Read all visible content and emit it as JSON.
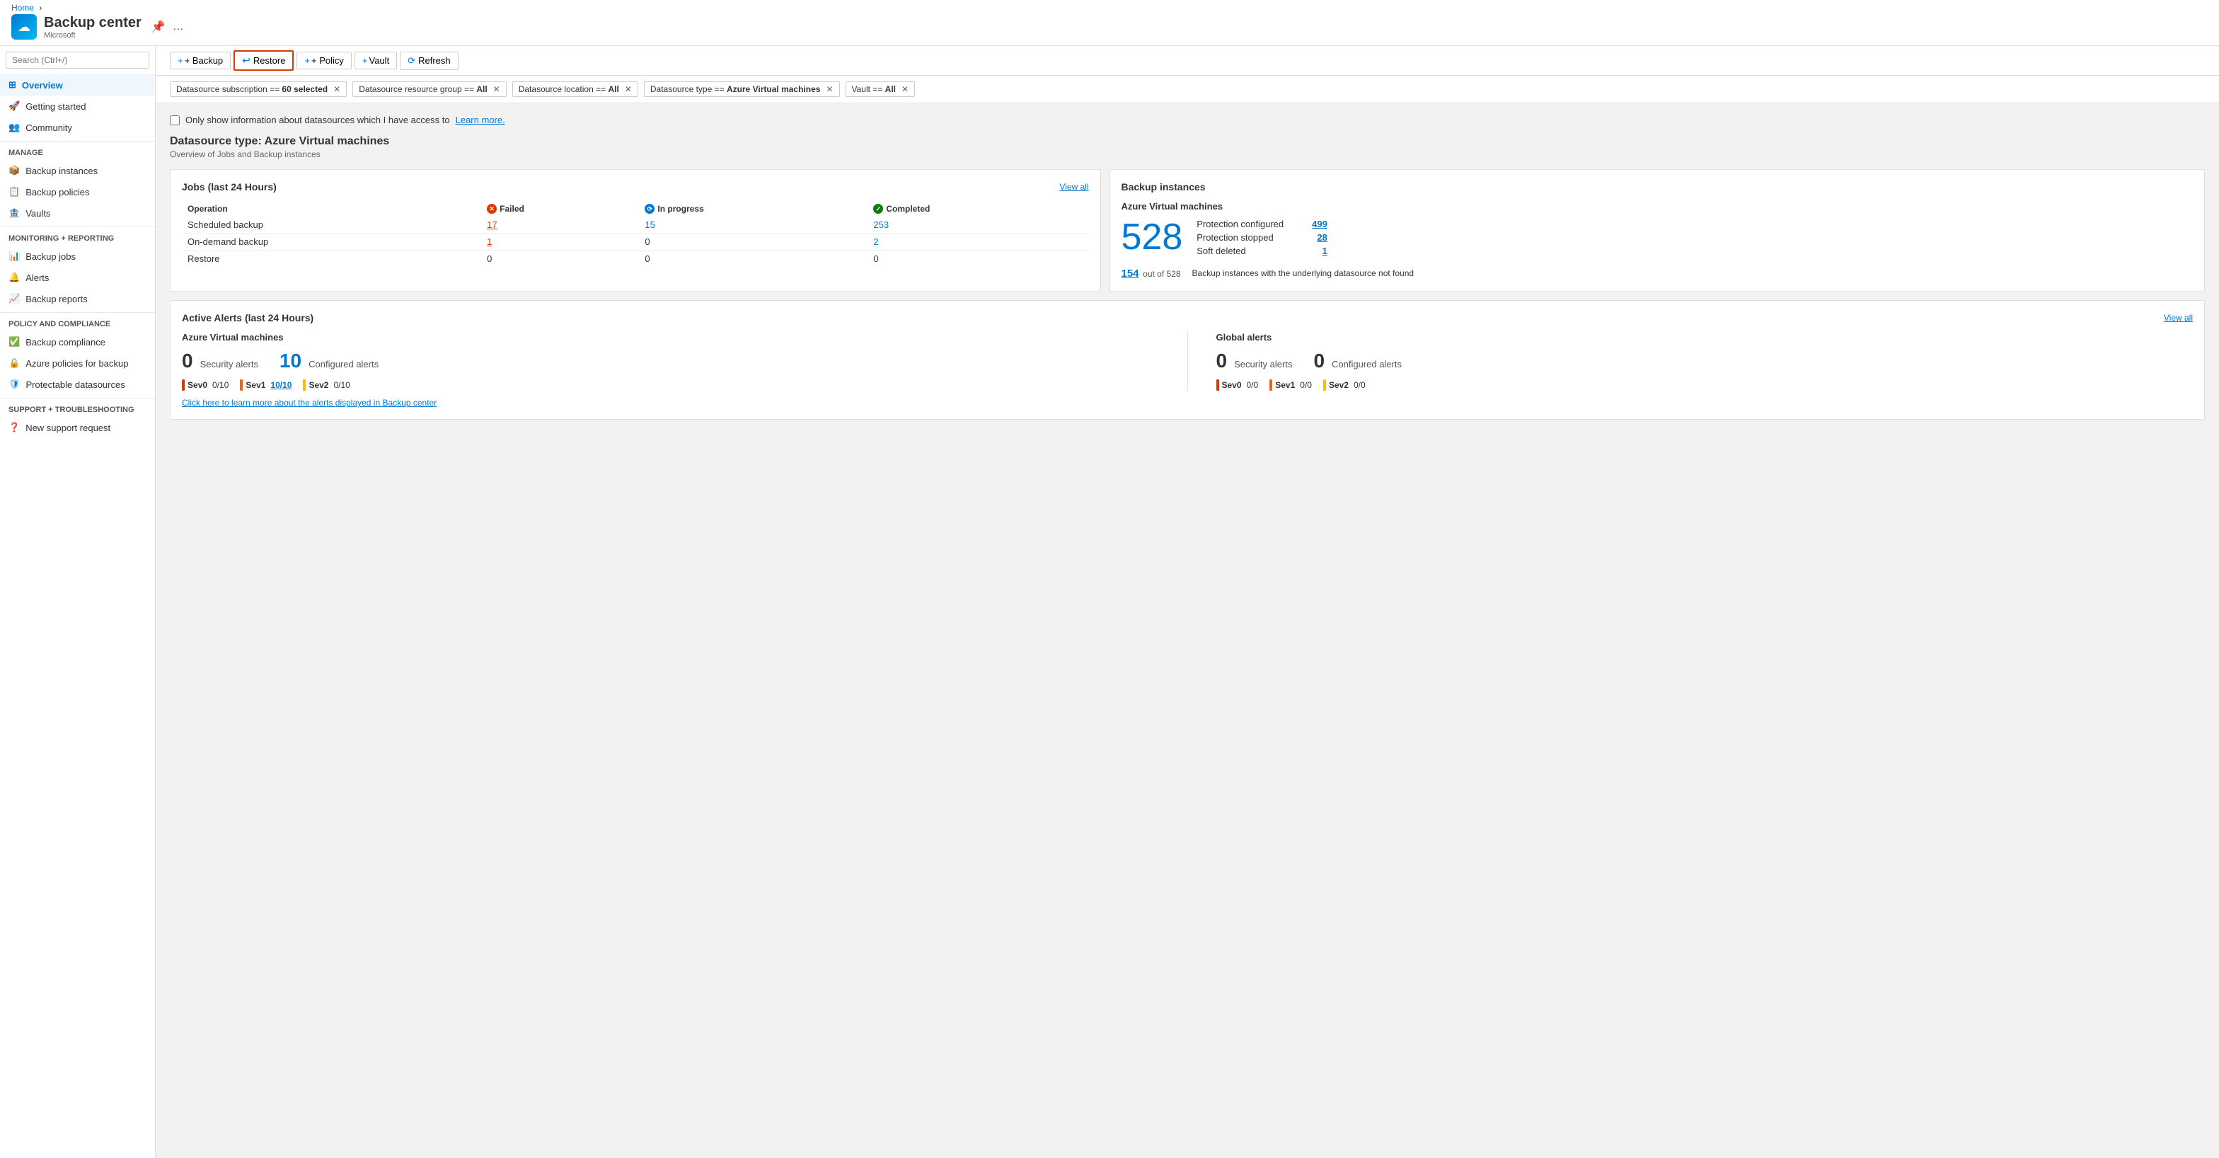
{
  "breadcrumb": {
    "home": "Home"
  },
  "app": {
    "title": "Backup center",
    "subtitle": "Microsoft",
    "icon": "☁"
  },
  "sidebar": {
    "search_placeholder": "Search (Ctrl+/)",
    "collapse_icon": "«",
    "nav_items": [
      {
        "id": "overview",
        "label": "Overview",
        "active": true,
        "icon": "⊞"
      },
      {
        "id": "getting-started",
        "label": "Getting started",
        "icon": "🚀"
      },
      {
        "id": "community",
        "label": "Community",
        "icon": "👥"
      }
    ],
    "sections": [
      {
        "label": "Manage",
        "items": [
          {
            "id": "backup-instances",
            "label": "Backup instances",
            "icon": "📦"
          },
          {
            "id": "backup-policies",
            "label": "Backup policies",
            "icon": "📋"
          },
          {
            "id": "vaults",
            "label": "Vaults",
            "icon": "🏦"
          }
        ]
      },
      {
        "label": "Monitoring + reporting",
        "items": [
          {
            "id": "backup-jobs",
            "label": "Backup jobs",
            "icon": "📊"
          },
          {
            "id": "alerts",
            "label": "Alerts",
            "icon": "🔔"
          },
          {
            "id": "backup-reports",
            "label": "Backup reports",
            "icon": "📈"
          }
        ]
      },
      {
        "label": "Policy and compliance",
        "items": [
          {
            "id": "backup-compliance",
            "label": "Backup compliance",
            "icon": "✅"
          },
          {
            "id": "azure-policies",
            "label": "Azure policies for backup",
            "icon": "🔒"
          },
          {
            "id": "protectable-datasources",
            "label": "Protectable datasources",
            "icon": "🛡"
          }
        ]
      },
      {
        "label": "Support + troubleshooting",
        "items": [
          {
            "id": "new-support",
            "label": "New support request",
            "icon": "❓"
          }
        ]
      }
    ]
  },
  "toolbar": {
    "backup_label": "+ Backup",
    "restore_label": "↩ Restore",
    "policy_label": "+ Policy",
    "vault_label": "+ Vault",
    "refresh_label": "⟳ Refresh"
  },
  "filters": [
    {
      "id": "datasource-subscription",
      "label": "Datasource subscription == ",
      "value": "60 selected"
    },
    {
      "id": "datasource-resource-group",
      "label": "Datasource resource group == ",
      "value": "All"
    },
    {
      "id": "datasource-location",
      "label": "Datasource location == ",
      "value": "All"
    },
    {
      "id": "datasource-type",
      "label": "Datasource type == ",
      "value": "Azure Virtual machines"
    },
    {
      "id": "vault",
      "label": "Vault == ",
      "value": "All"
    }
  ],
  "checkbox": {
    "label": "Only show information about datasources which I have access to",
    "link_text": "Learn more."
  },
  "page": {
    "datasource_title": "Datasource type: Azure Virtual machines",
    "datasource_subtitle": "Overview of Jobs and Backup instances"
  },
  "jobs_card": {
    "title": "Jobs (last 24 Hours)",
    "view_all": "View all",
    "headers": [
      "Operation",
      "Failed",
      "In progress",
      "Completed"
    ],
    "rows": [
      {
        "operation": "Scheduled backup",
        "failed": "17",
        "in_progress": "15",
        "completed": "253"
      },
      {
        "operation": "On-demand backup",
        "failed": "1",
        "in_progress": "0",
        "completed": "2"
      },
      {
        "operation": "Restore",
        "failed": "0",
        "in_progress": "0",
        "completed": "0"
      }
    ]
  },
  "backup_instances_card": {
    "title": "Backup instances",
    "subtitle": "Azure Virtual machines",
    "total": "528",
    "protection_configured_label": "Protection configured",
    "protection_configured_value": "499",
    "protection_stopped_label": "Protection stopped",
    "protection_stopped_value": "28",
    "soft_deleted_label": "Soft deleted",
    "soft_deleted_value": "1",
    "footer_num": "154",
    "footer_of": "out of 528",
    "footer_desc": "Backup instances with the underlying datasource not found"
  },
  "alerts_card": {
    "title": "Active Alerts (last 24 Hours)",
    "view_all": "View all",
    "azure_section": {
      "title": "Azure Virtual machines",
      "security_count": "0",
      "security_label": "Security alerts",
      "configured_count": "10",
      "configured_label": "Configured alerts",
      "sev_items": [
        {
          "label": "Sev0",
          "value": "0/10",
          "color": "red",
          "is_link": false
        },
        {
          "label": "Sev1",
          "value": "10/10",
          "color": "orange",
          "is_link": true
        },
        {
          "label": "Sev2",
          "value": "0/10",
          "color": "yellow",
          "is_link": false
        }
      ]
    },
    "global_section": {
      "title": "Global alerts",
      "security_count": "0",
      "security_label": "Security alerts",
      "configured_count": "0",
      "configured_label": "Configured alerts",
      "sev_items": [
        {
          "label": "Sev0",
          "value": "0/0",
          "color": "red",
          "is_link": false
        },
        {
          "label": "Sev1",
          "value": "0/0",
          "color": "orange",
          "is_link": false
        },
        {
          "label": "Sev2",
          "value": "0/0",
          "color": "yellow",
          "is_link": false
        }
      ]
    },
    "footer_link": "Click here to learn more about the alerts displayed in Backup center"
  }
}
